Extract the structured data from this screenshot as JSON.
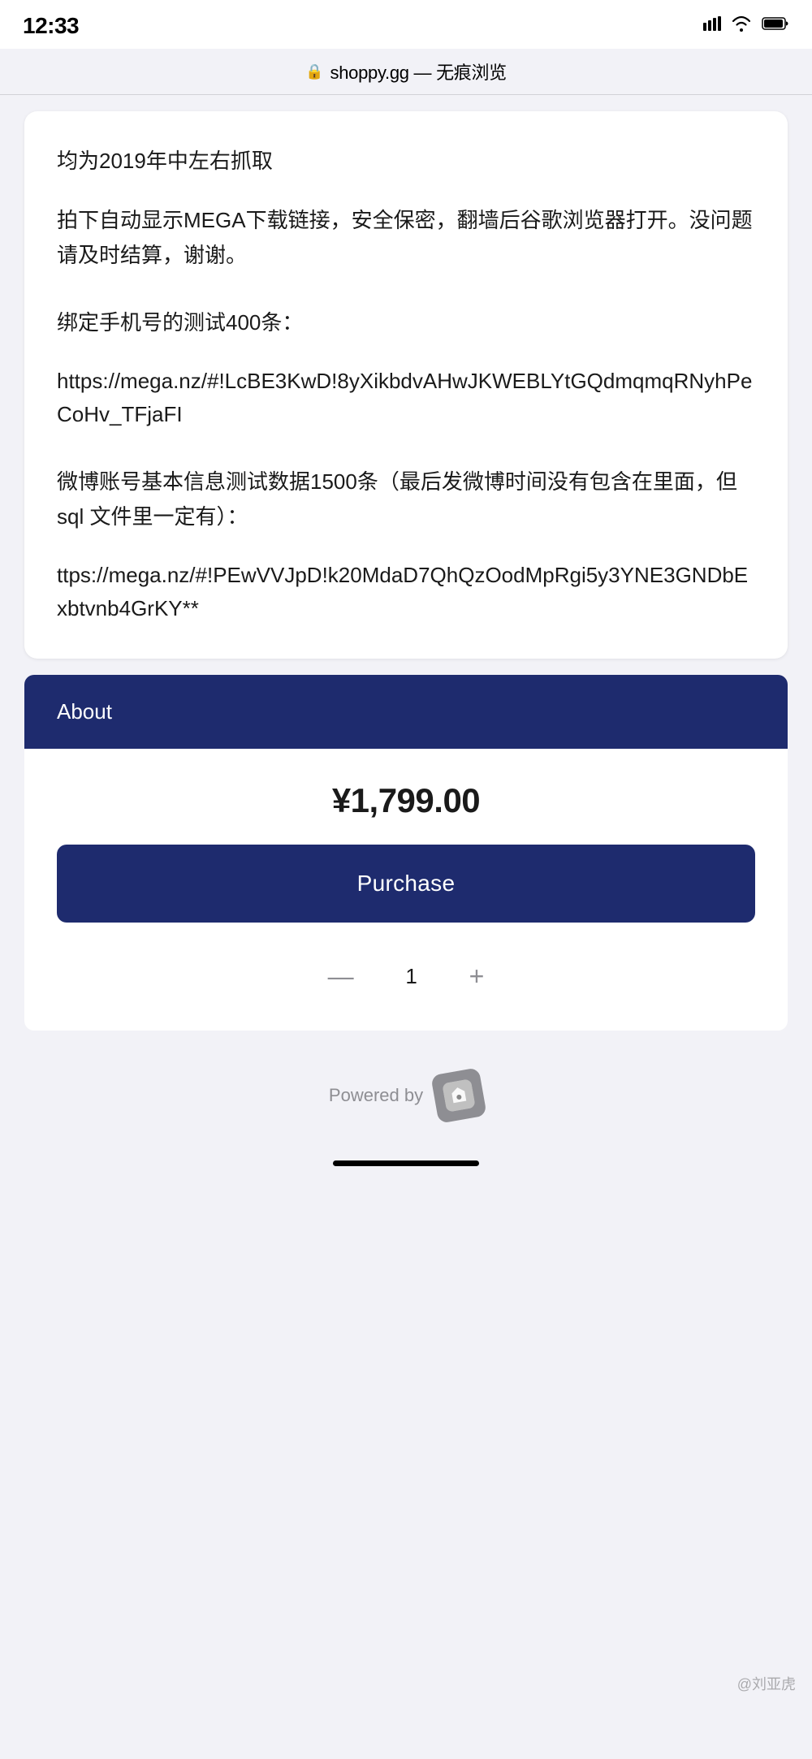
{
  "statusBar": {
    "time": "12:33"
  },
  "browserBar": {
    "url": "shoppy.gg — 无痕浏览",
    "lockIcon": "🔒"
  },
  "content": {
    "paragraph1": "均为2019年中左右抓取",
    "paragraph2": "拍下自动显示MEGA下载链接，安全保密，翻墙后谷歌浏览器打开。没问题请及时结算，谢谢。",
    "paragraph3": "绑定手机号的测试400条：",
    "link1": "https://mega.nz/#!LcBE3KwD!8yXikbdvAHwJKWEBLYtGQdmqmqRNyhPeCoHv_TFjaFI",
    "paragraph4": "微博账号基本信息测试数据1500条（最后发微博时间没有包含在里面，但 sql 文件里一定有）：",
    "link2": "ttps://mega.nz/#!PEwVVJpD!k20MdaD7QhQzOodMpRgi5y3YNE3GNDbExbtvnb4GrKY**"
  },
  "about": {
    "label": "About"
  },
  "pricing": {
    "price": "¥1,799.00"
  },
  "actions": {
    "purchaseLabel": "Purchase",
    "quantityMinus": "—",
    "quantityValue": "1",
    "quantityPlus": "+"
  },
  "footer": {
    "poweredByText": "Powered by"
  },
  "watermark": "@刘亚虎"
}
